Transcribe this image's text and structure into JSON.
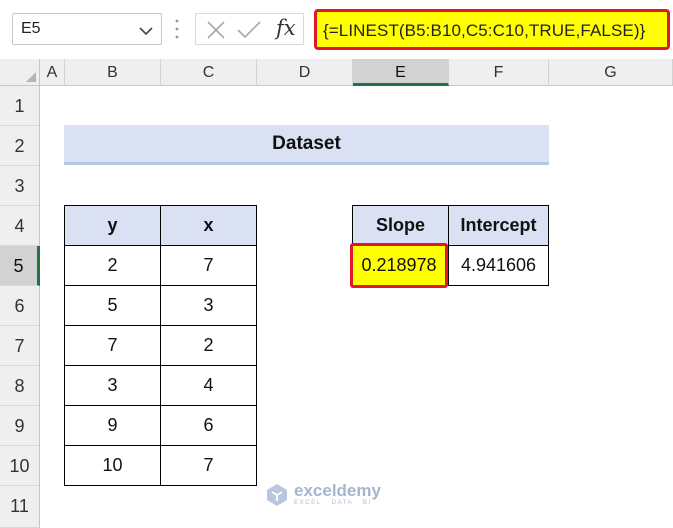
{
  "formula_bar": {
    "name_box": "E5",
    "fx_label": "fx",
    "formula": "{=LINEST(B5:B10,C5:C10,TRUE,FALSE)}"
  },
  "columns": [
    "A",
    "B",
    "C",
    "D",
    "E",
    "F",
    "G"
  ],
  "rows": [
    "1",
    "2",
    "3",
    "4",
    "5",
    "6",
    "7",
    "8",
    "9",
    "10",
    "11"
  ],
  "active_cell": {
    "column": "E",
    "row": "5"
  },
  "dataset": {
    "title": "Dataset",
    "headers": [
      "y",
      "x"
    ],
    "rows": [
      [
        "2",
        "7"
      ],
      [
        "5",
        "3"
      ],
      [
        "7",
        "2"
      ],
      [
        "3",
        "4"
      ],
      [
        "9",
        "6"
      ],
      [
        "10",
        "7"
      ]
    ]
  },
  "result": {
    "headers": [
      "Slope",
      "Intercept"
    ],
    "values": [
      "0.218978",
      "4.941606"
    ]
  },
  "colors": {
    "highlight_yellow": "#ffff00",
    "highlight_border_red": "#e0192a",
    "header_blue": "#d9e1f2",
    "excel_green": "#217346"
  },
  "watermark": {
    "name": "exceldemy",
    "tagline": "EXCEL · DATA · BI"
  }
}
